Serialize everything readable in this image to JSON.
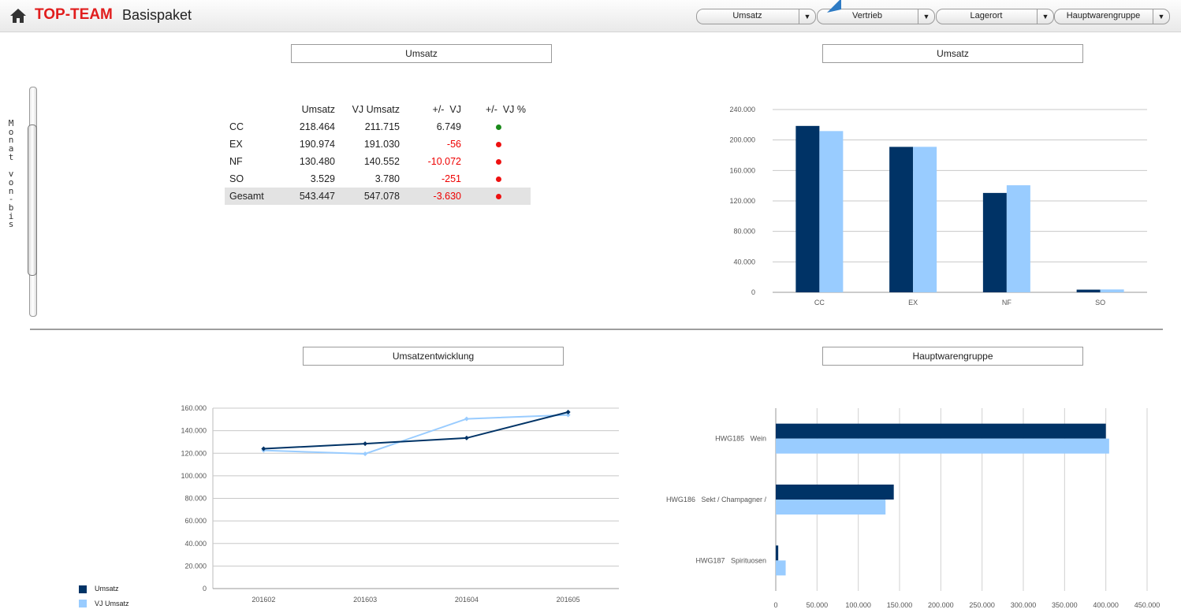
{
  "header": {
    "brand": "TOP-TEAM",
    "subtitle": "Basispaket",
    "dropdowns": [
      "Umsatz",
      "Vertrieb",
      "Lagerort",
      "Hauptwarengruppe"
    ]
  },
  "slider": {
    "label": "Monat von-bis"
  },
  "panels": {
    "table_title": "Umsatz",
    "bar_title": "Umsatz",
    "line_title": "Umsatzentwicklung",
    "hbar_title": "Hauptwarengruppe"
  },
  "kpi_table": {
    "headers": [
      "",
      "Umsatz",
      "VJ Umsatz",
      "+/-  VJ",
      "+/-  VJ %"
    ],
    "rows": [
      {
        "label": "CC",
        "umsatz": "218.464",
        "vj": "211.715",
        "diff": "6.749",
        "status": "green"
      },
      {
        "label": "EX",
        "umsatz": "190.974",
        "vj": "191.030",
        "diff": "-56",
        "status": "red"
      },
      {
        "label": "NF",
        "umsatz": "130.480",
        "vj": "140.552",
        "diff": "-10.072",
        "status": "red"
      },
      {
        "label": "SO",
        "umsatz": "3.529",
        "vj": "3.780",
        "diff": "-251",
        "status": "red"
      }
    ],
    "total": {
      "label": "Gesamt",
      "umsatz": "543.447",
      "vj": "547.078",
      "diff": "-3.630",
      "status": "red"
    }
  },
  "colors": {
    "umsatz": "#003366",
    "vj": "#99ccff",
    "green": "#1a8a1a",
    "red": "#ee1111",
    "brand": "#e11d1d"
  },
  "chart_data": [
    {
      "type": "bar",
      "title": "Umsatz",
      "categories": [
        "CC",
        "EX",
        "NF",
        "SO"
      ],
      "series": [
        {
          "values": [
            218464,
            190974,
            130480,
            3529
          ]
        },
        {
          "values": [
            211715,
            191030,
            140552,
            3780
          ]
        }
      ],
      "ylim": [
        0,
        240000
      ],
      "yticks": [
        "0",
        "40.000",
        "80.000",
        "120.000",
        "160.000",
        "200.000",
        "240.000"
      ],
      "grid": true
    },
    {
      "type": "line",
      "title": "Umsatzentwicklung",
      "categories": [
        "201602",
        "201603",
        "201604",
        "201605"
      ],
      "series": [
        {
          "name": "Umsatz",
          "values": [
            124000,
            128500,
            133500,
            156500
          ]
        },
        {
          "name": "VJ Umsatz",
          "values": [
            122500,
            119500,
            150500,
            154000
          ]
        }
      ],
      "ylim": [
        0,
        160000
      ],
      "yticks": [
        "0",
        "20.000",
        "40.000",
        "60.000",
        "80.000",
        "100.000",
        "120.000",
        "140.000",
        "160.000"
      ],
      "legend": "bottom-left",
      "grid": true
    },
    {
      "type": "bar",
      "orientation": "horizontal",
      "title": "Hauptwarengruppe",
      "categories": [
        "HWG185   Wein",
        "HWG186   Sekt / Champagner /",
        "HWG187   Spirituosen"
      ],
      "series": [
        {
          "values": [
            400000,
            143000,
            3000
          ]
        },
        {
          "values": [
            404000,
            133000,
            12000
          ]
        }
      ],
      "xlim": [
        0,
        450000
      ],
      "xticks": [
        "0",
        "50.000",
        "100.000",
        "150.000",
        "200.000",
        "250.000",
        "300.000",
        "350.000",
        "400.000",
        "450.000"
      ],
      "grid": true
    }
  ]
}
